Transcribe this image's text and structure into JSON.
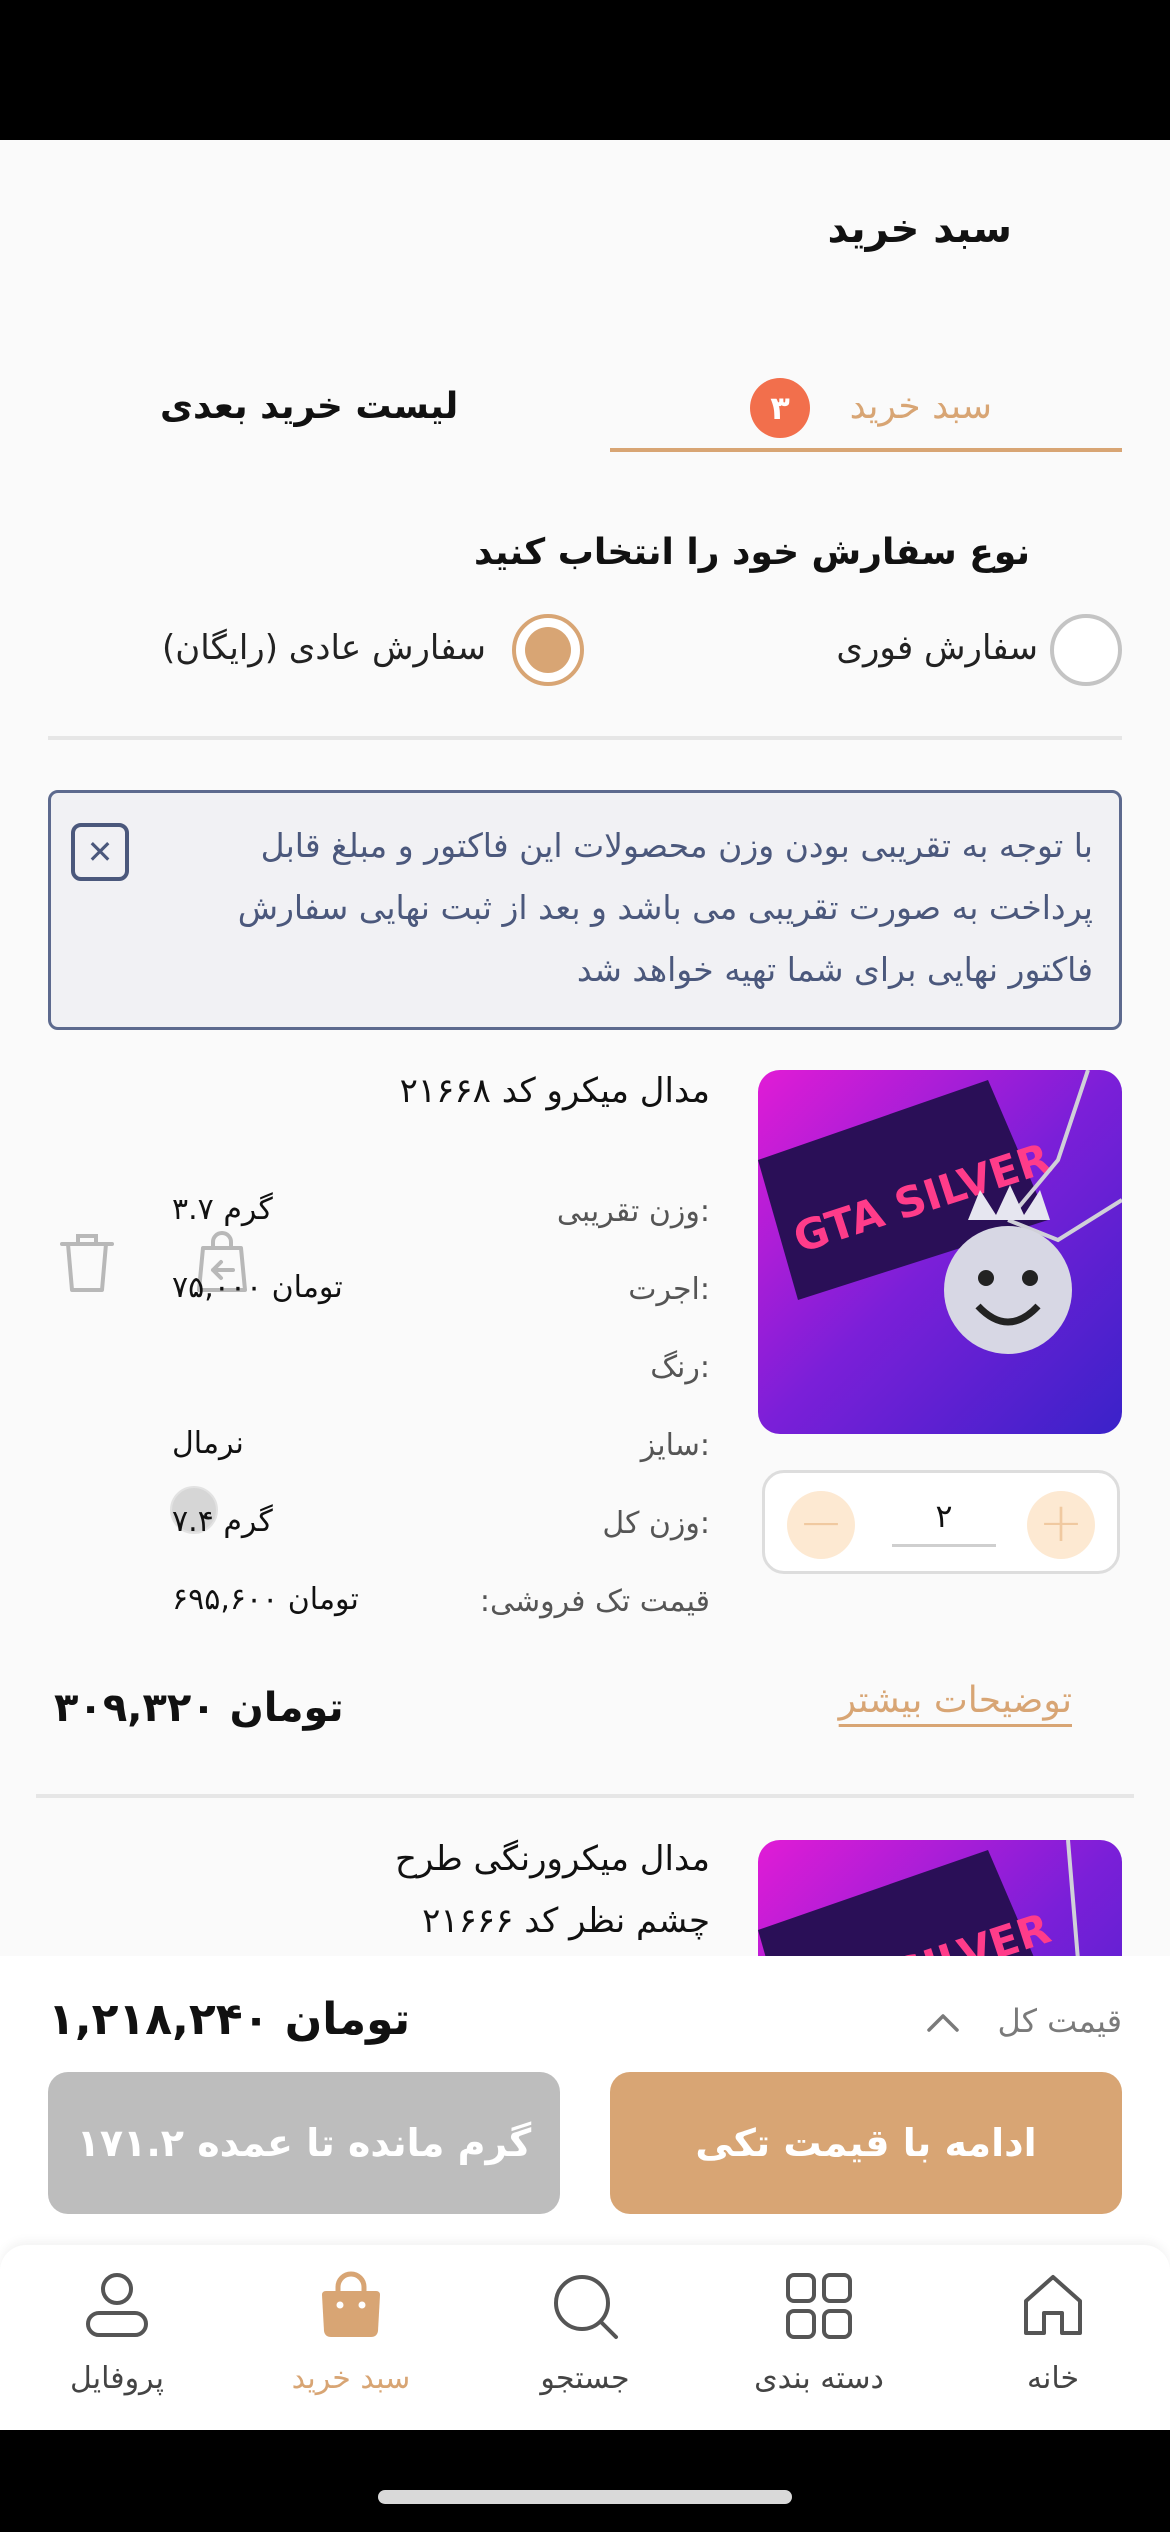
{
  "header": {
    "title": "سبد خرید"
  },
  "tabs": {
    "cart_label": "سبد خرید",
    "cart_count": "۳",
    "later_label": "لیست خرید بعدی"
  },
  "order_type": {
    "heading": "نوع سفارش خود را انتخاب کنید",
    "options": [
      {
        "label": "سفارش فوری",
        "selected": false
      },
      {
        "label": "سفارش عادی (رایگان)",
        "selected": true
      }
    ]
  },
  "notice": {
    "text": "با توجه به تقریبی بودن وزن محصولات این فاکتور و مبلغ قابل پرداخت به صورت تقریبی می باشد و بعد از ثبت نهایی سفارش فاکتور نهایی برای شما تهیه خواهد شد",
    "close_icon": "close-icon"
  },
  "items": [
    {
      "title": "مدال میکرو کد ۲۱۶۶۸",
      "specs": [
        {
          "label": "وزن تقریبی:",
          "value": "۳.۷ گرم"
        },
        {
          "label": "اجرت:",
          "value": "۷۵,۰۰۰ تومان"
        },
        {
          "label": "رنگ:",
          "value": ""
        },
        {
          "label": "سایز:",
          "value": "نرمال"
        },
        {
          "label": "وزن کل:",
          "value": "۷.۴ گرم"
        },
        {
          "label": ":قیمت تک فروشی",
          "value": "۶۹۵,۶۰۰ تومان"
        }
      ],
      "quantity": "۲",
      "more_label": "توضیحات بیشتر",
      "line_total": "۳۰۹,۳۲۰ تومان",
      "color_swatch": "#d6d6d6"
    },
    {
      "title": "مدال میکرورنگی طرح چشم نظر کد ۲۱۶۶۶"
    }
  ],
  "checkout": {
    "total_label": "قیمت کل",
    "total_value": "۱,۲۱۸,۲۴۰ تومان",
    "continue_button": "ادامه با قیمت تکی",
    "wholesale_button": "۱۷۱.۲ گرم مانده تا عمده"
  },
  "nav": {
    "items": [
      {
        "label": "خانه",
        "icon": "home-icon",
        "active": false
      },
      {
        "label": "دسته بندی",
        "icon": "grid-icon",
        "active": false
      },
      {
        "label": "جستجو",
        "icon": "search-icon",
        "active": false
      },
      {
        "label": "سبد خرید",
        "icon": "bag-icon",
        "active": true
      },
      {
        "label": "پروفایل",
        "icon": "user-icon",
        "active": false
      }
    ]
  },
  "colors": {
    "accent": "#d8a574",
    "badge": "#f26f4c",
    "notice_text": "#4b587c",
    "disabled": "#bdbdbd"
  }
}
